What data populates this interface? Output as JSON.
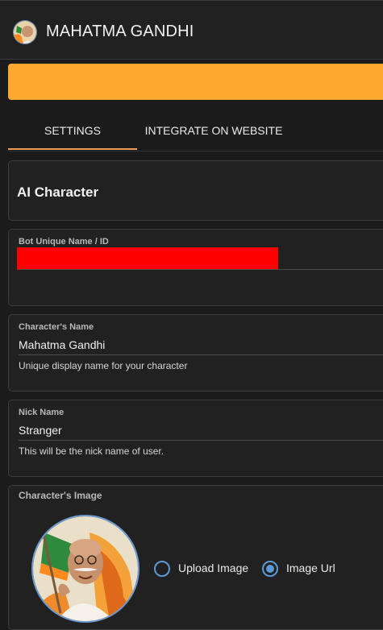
{
  "header": {
    "title": "MAHATMA GANDHI",
    "avatar_icon": "character-avatar"
  },
  "banner": {
    "color": "#ffa830"
  },
  "tabs": [
    {
      "label": "SETTINGS",
      "active": true
    },
    {
      "label": "INTEGRATE ON WEBSITE",
      "active": false
    }
  ],
  "section": {
    "heading": "AI Character"
  },
  "fields": {
    "bot_id": {
      "label": "Bot Unique Name / ID",
      "value": ""
    },
    "character_name": {
      "label": "Character's Name",
      "value": "Mahatma Gandhi",
      "help": "Unique display name for your character"
    },
    "nick_name": {
      "label": "Nick Name",
      "value": "Stranger",
      "help": "This will be the nick name of user."
    }
  },
  "image_section": {
    "label": "Character's Image",
    "options": [
      {
        "label": "Upload Image",
        "selected": false
      },
      {
        "label": "Image Url",
        "selected": true
      }
    ]
  },
  "colors": {
    "accent": "#ffa830",
    "tab_underline": "#f09a55",
    "radio": "#5b9ad6",
    "redaction": "#ff0000"
  }
}
